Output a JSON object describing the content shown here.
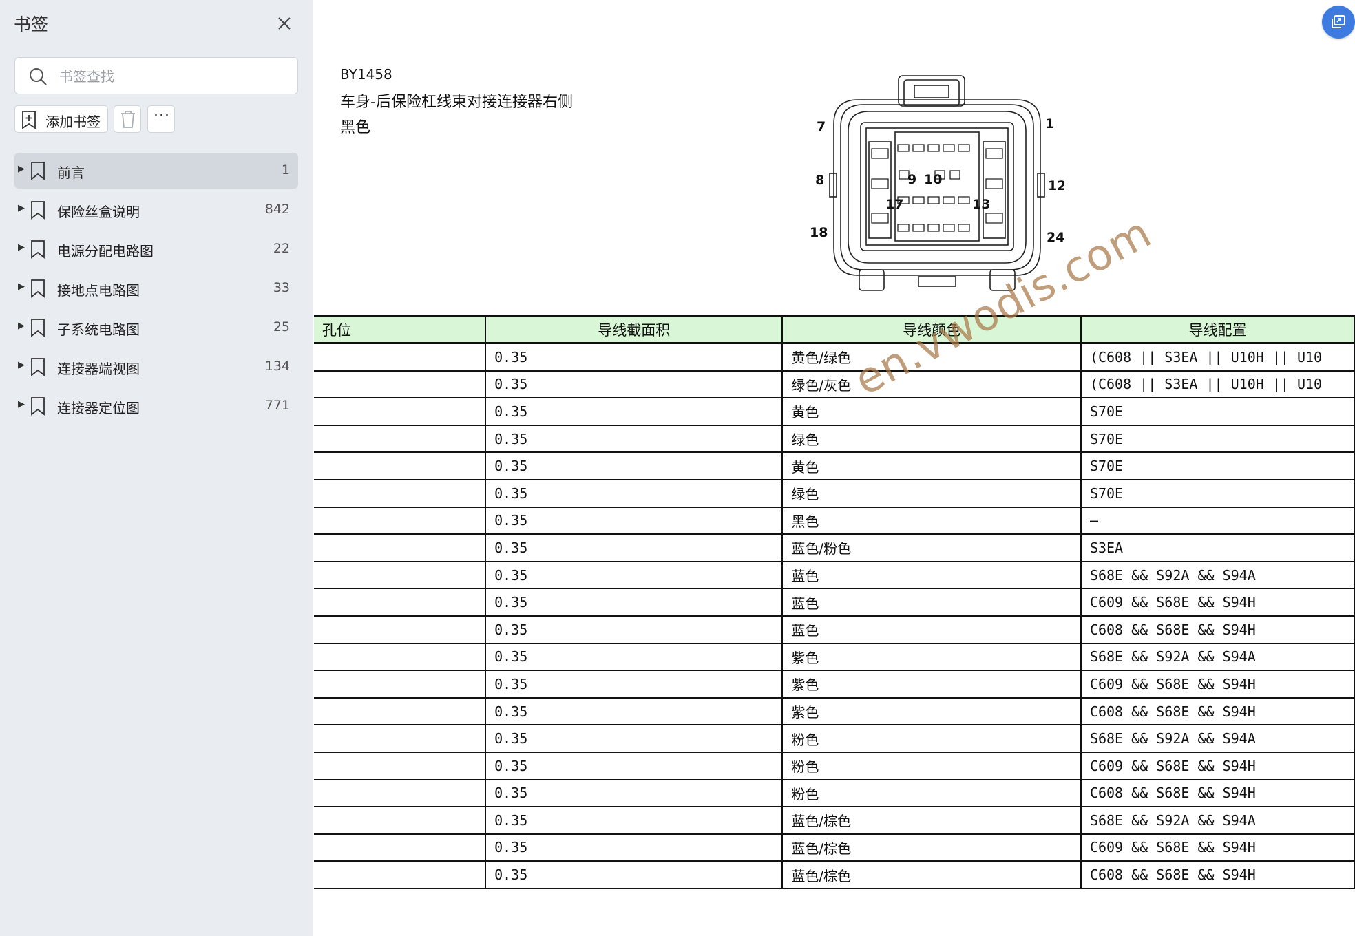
{
  "sidebar": {
    "title": "书签",
    "search_placeholder": "书签查找",
    "add_bookmark_label": "添加书签",
    "more_label": "···",
    "items": [
      {
        "label": "前言",
        "page": "1"
      },
      {
        "label": "保险丝盒说明",
        "page": "842"
      },
      {
        "label": "电源分配电路图",
        "page": "22"
      },
      {
        "label": "接地点电路图",
        "page": "33"
      },
      {
        "label": "子系统电路图",
        "page": "25"
      },
      {
        "label": "连接器端视图",
        "page": "134"
      },
      {
        "label": "连接器定位图",
        "page": "771"
      }
    ]
  },
  "document": {
    "connector_id": "BY1458",
    "connector_desc": "车身-后保险杠线束对接连接器右侧",
    "connector_color": "黑色",
    "pin_labels": [
      "7",
      "1",
      "8",
      "9",
      "10",
      "12",
      "17",
      "13",
      "18",
      "24"
    ],
    "table": {
      "headers": [
        "孔位",
        "导线截面积",
        "导线颜色",
        "导线配置"
      ],
      "rows": [
        {
          "hole": "",
          "area": "0.35",
          "color": "黄色/绿色",
          "config": "(C608 || S3EA || U10H || U10"
        },
        {
          "hole": "",
          "area": "0.35",
          "color": "绿色/灰色",
          "config": "(C608 || S3EA || U10H || U10"
        },
        {
          "hole": "",
          "area": "0.35",
          "color": "黄色",
          "config": "S70E"
        },
        {
          "hole": "",
          "area": "0.35",
          "color": "绿色",
          "config": "S70E"
        },
        {
          "hole": "",
          "area": "0.35",
          "color": "黄色",
          "config": "S70E"
        },
        {
          "hole": "",
          "area": "0.35",
          "color": "绿色",
          "config": "S70E"
        },
        {
          "hole": "",
          "area": "0.35",
          "color": "黑色",
          "config": "–"
        },
        {
          "hole": "",
          "area": "0.35",
          "color": "蓝色/粉色",
          "config": "S3EA"
        },
        {
          "hole": "",
          "area": "0.35",
          "color": "蓝色",
          "config": "S68E && S92A && S94A"
        },
        {
          "hole": "",
          "area": "0.35",
          "color": "蓝色",
          "config": "C609 && S68E && S94H"
        },
        {
          "hole": "",
          "area": "0.35",
          "color": "蓝色",
          "config": "C608 && S68E && S94H"
        },
        {
          "hole": "",
          "area": "0.35",
          "color": "紫色",
          "config": "S68E && S92A && S94A"
        },
        {
          "hole": "",
          "area": "0.35",
          "color": "紫色",
          "config": "C609 && S68E && S94H"
        },
        {
          "hole": "",
          "area": "0.35",
          "color": "紫色",
          "config": "C608 && S68E && S94H"
        },
        {
          "hole": "",
          "area": "0.35",
          "color": "粉色",
          "config": "S68E && S92A && S94A"
        },
        {
          "hole": "",
          "area": "0.35",
          "color": "粉色",
          "config": "C609 && S68E && S94H"
        },
        {
          "hole": "",
          "area": "0.35",
          "color": "粉色",
          "config": "C608 && S68E && S94H"
        },
        {
          "hole": "",
          "area": "0.35",
          "color": "蓝色/棕色",
          "config": "S68E && S92A && S94A"
        },
        {
          "hole": "",
          "area": "0.35",
          "color": "蓝色/棕色",
          "config": "C609 && S68E && S94H"
        },
        {
          "hole": "",
          "area": "0.35",
          "color": "蓝色/棕色",
          "config": "C608 && S68E && S94H"
        }
      ]
    },
    "watermark": "en.vwodis.com"
  },
  "colors": {
    "sidebar_bg": "#e9edf1",
    "selected_item_bg": "#d3d8de",
    "table_header_bg": "#d9f7d7",
    "accent_blue": "#3e7be0",
    "watermark": "#a87848"
  },
  "icons": {
    "close": "close-icon",
    "search": "search-icon",
    "add_bookmark": "bookmark-add-icon",
    "delete": "trash-icon",
    "more": "more-icon",
    "bookmark": "bookmark-icon",
    "expand": "triangle-right-icon",
    "float": "window-icon"
  }
}
